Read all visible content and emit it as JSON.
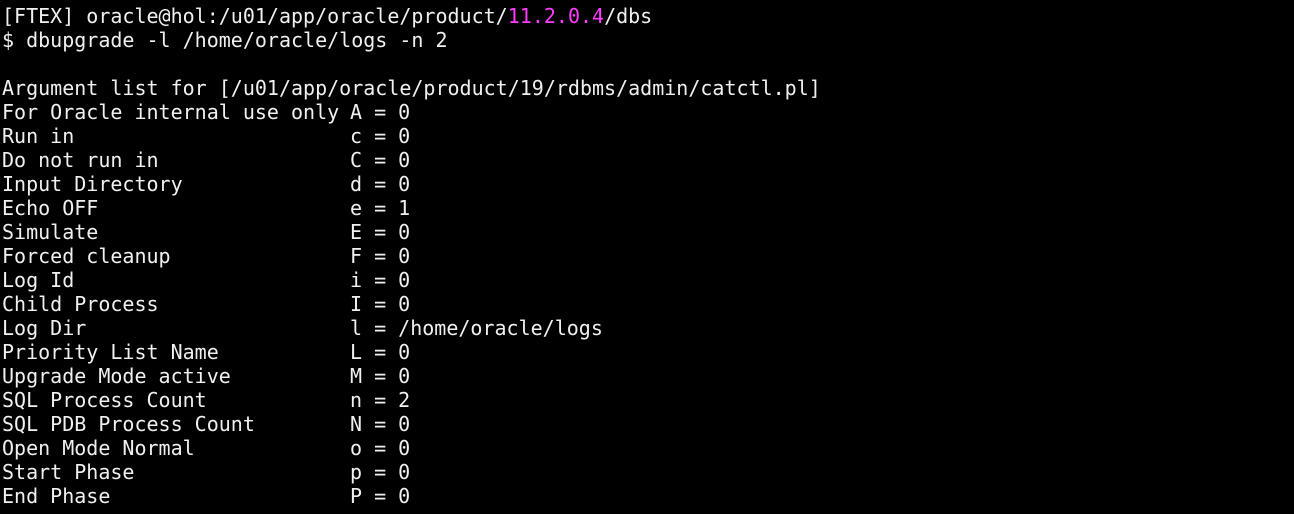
{
  "prompt": {
    "prefix": "[FTEX] oracle@hol:/u01/app/oracle/product/",
    "highlight": "11.2.0.4",
    "suffix": "/dbs"
  },
  "command": "$ dbupgrade -l /home/oracle/logs -n 2",
  "header": "Argument list for [/u01/app/oracle/product/19/rdbms/admin/catctl.pl]",
  "args": [
    {
      "desc": "For Oracle internal use only",
      "flag": "A = 0"
    },
    {
      "desc": "Run in",
      "flag": "c = 0"
    },
    {
      "desc": "Do not run in",
      "flag": "C = 0"
    },
    {
      "desc": "Input Directory",
      "flag": "d = 0"
    },
    {
      "desc": "Echo OFF",
      "flag": "e = 1"
    },
    {
      "desc": "Simulate",
      "flag": "E = 0"
    },
    {
      "desc": "Forced cleanup",
      "flag": "F = 0"
    },
    {
      "desc": "Log Id",
      "flag": "i = 0"
    },
    {
      "desc": "Child Process",
      "flag": "I = 0"
    },
    {
      "desc": "Log Dir",
      "flag": "l = /home/oracle/logs"
    },
    {
      "desc": "Priority List Name",
      "flag": "L = 0"
    },
    {
      "desc": "Upgrade Mode active",
      "flag": "M = 0"
    },
    {
      "desc": "SQL Process Count",
      "flag": "n = 2"
    },
    {
      "desc": "SQL PDB Process Count",
      "flag": "N = 0"
    },
    {
      "desc": "Open Mode Normal",
      "flag": "o = 0"
    },
    {
      "desc": "Start Phase",
      "flag": "p = 0"
    },
    {
      "desc": "End Phase",
      "flag": "P = 0"
    }
  ],
  "colors": {
    "background": "#000000",
    "text": "#f0f0f0",
    "highlight": "#ff3cff"
  }
}
